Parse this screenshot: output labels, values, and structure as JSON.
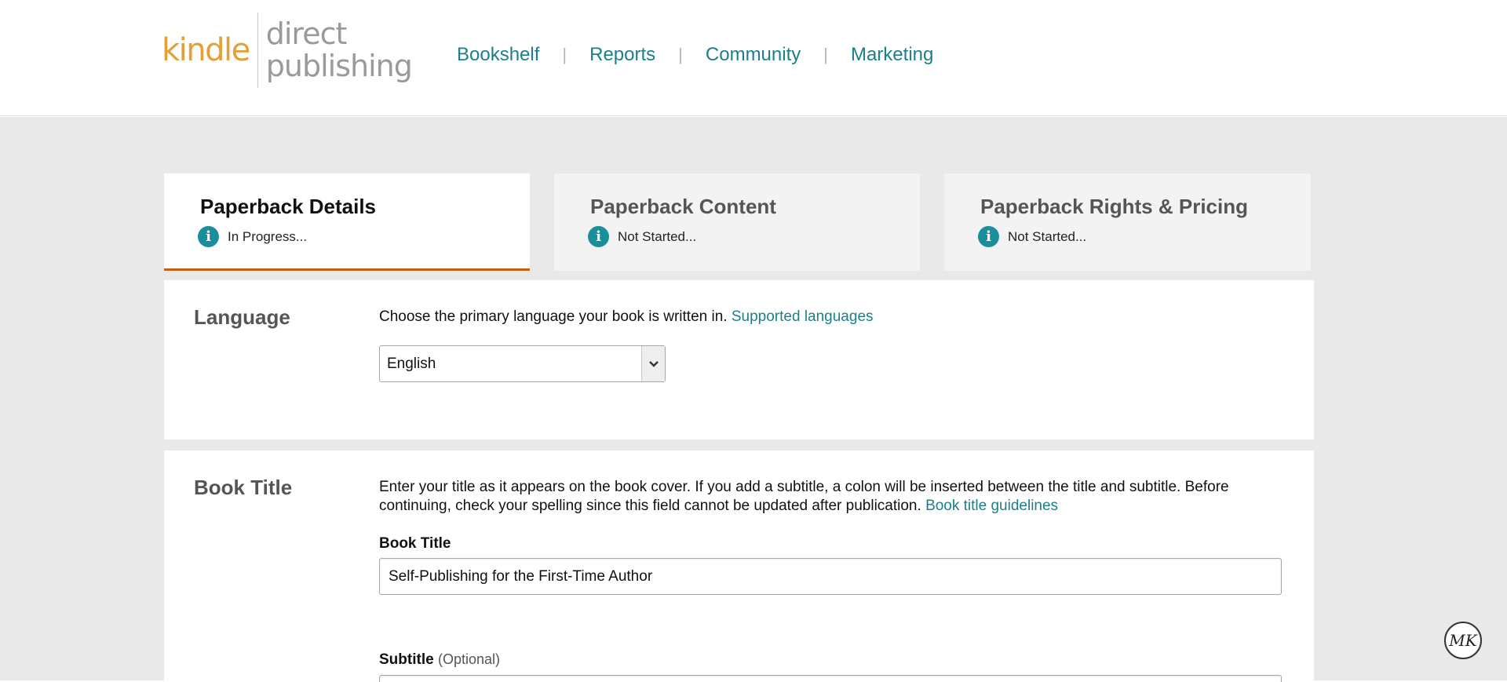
{
  "logo": {
    "brand": "kindle",
    "product_line1": "direct",
    "product_line2": "publishing"
  },
  "nav": {
    "items": [
      "Bookshelf",
      "Reports",
      "Community",
      "Marketing"
    ],
    "separator": "|"
  },
  "tabs": [
    {
      "title": "Paperback Details",
      "status": "In Progress...",
      "active": true
    },
    {
      "title": "Paperback Content",
      "status": "Not Started...",
      "active": false
    },
    {
      "title": "Paperback Rights & Pricing",
      "status": "Not Started...",
      "active": false
    }
  ],
  "language": {
    "heading": "Language",
    "description": "Choose the primary language your book is written in.",
    "link": "Supported languages",
    "selected": "English"
  },
  "book_title": {
    "heading": "Book Title",
    "description": "Enter your title as it appears on the book cover. If you add a subtitle, a colon will be inserted between the title and subtitle. Before continuing, check your spelling since this field cannot be updated after publication.",
    "link": "Book title guidelines",
    "title_label": "Book Title",
    "title_value": "Self-Publishing for the First-Time Author",
    "subtitle_label": "Subtitle",
    "subtitle_optional": "(Optional)"
  },
  "colors": {
    "accent": "#1b7f8c",
    "active_tab_border": "#c45f15",
    "logo_kindle": "#e5a035",
    "info_icon": "#1a8f9c"
  },
  "info_icon_glyph": "i",
  "badge": {
    "initials": "MK"
  }
}
